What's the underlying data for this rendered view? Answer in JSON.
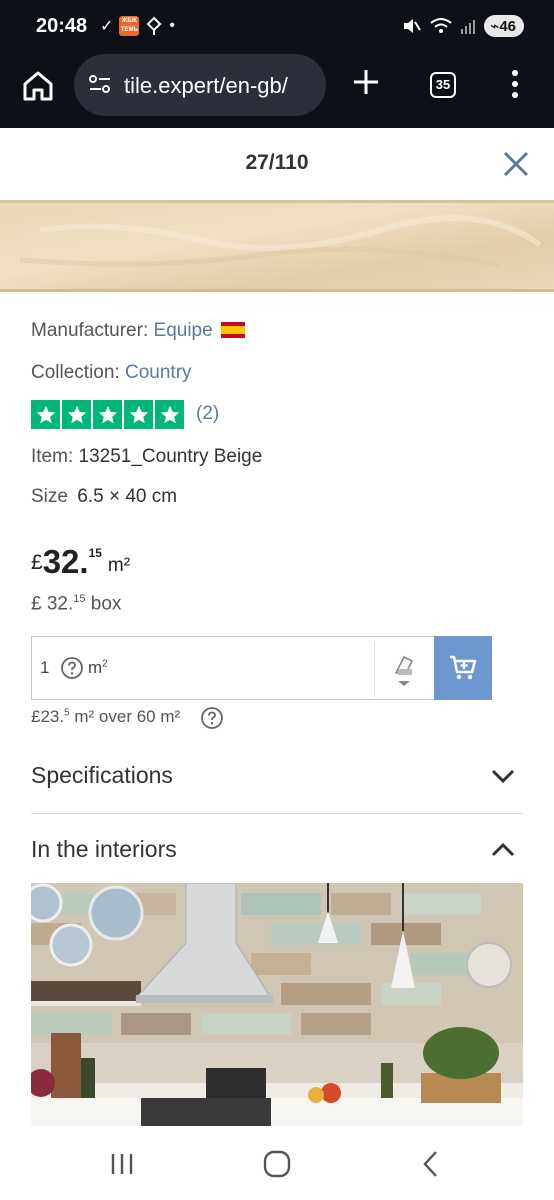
{
  "status": {
    "time": "20:48",
    "battery": "46",
    "notif_box_text": "ЖБЖ ТЕМЬ"
  },
  "browser": {
    "url": "tile.expert/en-gb/",
    "tab_count": "35"
  },
  "modal": {
    "pager": "27/110"
  },
  "product": {
    "manufacturer_label": "Manufacturer:",
    "manufacturer": "Equipe",
    "collection_label": "Collection:",
    "collection": "Country",
    "rating": 5,
    "reviews": "(2)",
    "item_label": "Item:",
    "item": "13251_Country Beige",
    "size_label": "Size",
    "size": "6.5 × 40 cm",
    "currency": "£",
    "price_int": "32.",
    "price_dec": "15",
    "price_unit": "m²",
    "box_price_int": "£ 32.",
    "box_price_dec": "15",
    "box_label": "box",
    "qty_value": "1",
    "qty_unit": "m",
    "bulk_price": "£23.",
    "bulk_dec": "5",
    "bulk_text": "m² over 60 m²"
  },
  "sections": {
    "specifications": "Specifications",
    "interiors": "In the interiors"
  },
  "colors": {
    "link": "#5b7aa3",
    "cart": "#6e97cf",
    "stars": "#00b67a",
    "tile": "#e6d4b2"
  }
}
